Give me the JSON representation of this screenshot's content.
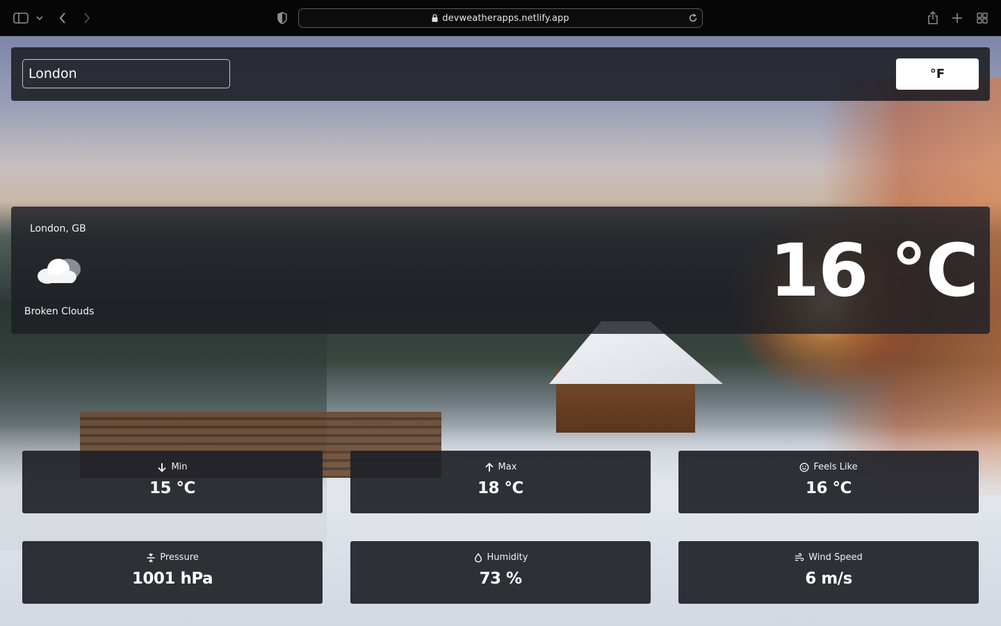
{
  "browser": {
    "url": "devweatherapps.netlify.app"
  },
  "search": {
    "city_value": "London",
    "unit_toggle_label": "°F"
  },
  "current": {
    "location": "London, GB",
    "condition": "Broken Clouds",
    "condition_icon": "cloud-icon",
    "temperature": "16 °C"
  },
  "stats": [
    {
      "label": "Min",
      "value": "15 °C",
      "icon": "arrow-down-icon"
    },
    {
      "label": "Max",
      "value": "18 °C",
      "icon": "arrow-up-icon"
    },
    {
      "label": "Feels Like",
      "value": "16 °C",
      "icon": "smile-icon"
    },
    {
      "label": "Pressure",
      "value": "1001 hPa",
      "icon": "pressure-icon"
    },
    {
      "label": "Humidity",
      "value": "73 %",
      "icon": "droplet-icon"
    },
    {
      "label": "Wind Speed",
      "value": "6 m/s",
      "icon": "wind-icon"
    }
  ]
}
